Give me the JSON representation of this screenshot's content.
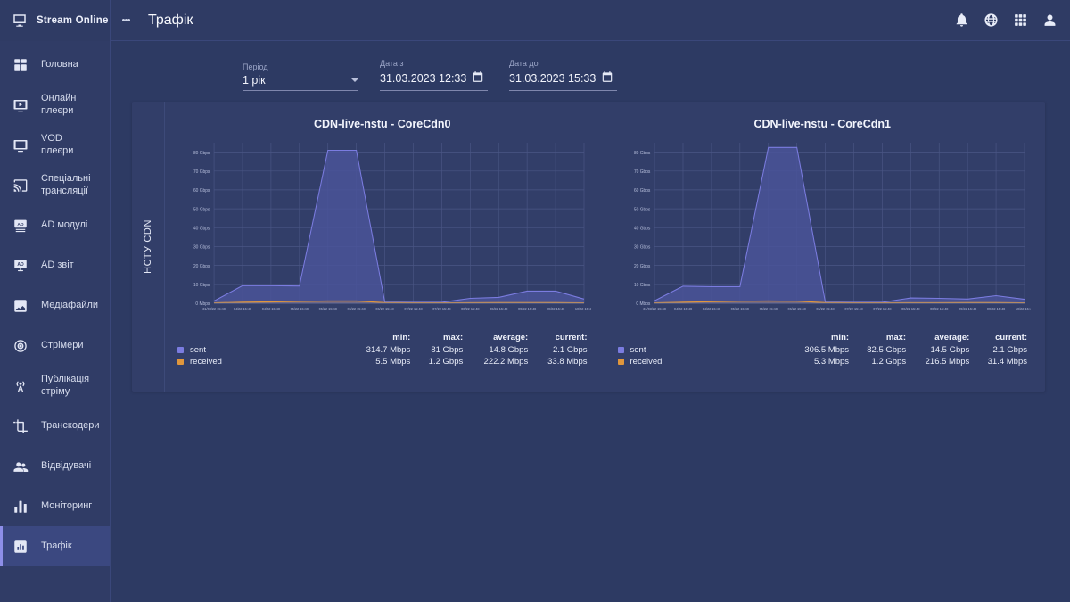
{
  "brand": {
    "title": "Stream Online",
    "icon": "monitor-stream-icon"
  },
  "sidebar": {
    "items": [
      {
        "label": "Головна",
        "icon": "dashboard-icon",
        "active": false
      },
      {
        "label": "Онлайн\nплеєри",
        "icon": "live-player-icon",
        "active": false
      },
      {
        "label": "VOD\nплеєри",
        "icon": "vod-player-icon",
        "active": false
      },
      {
        "label": "Спеціальні\nтрансляції",
        "icon": "cast-icon",
        "active": false
      },
      {
        "label": "AD модулі",
        "icon": "ad-module-icon",
        "active": false
      },
      {
        "label": "AD звіт",
        "icon": "ad-report-icon",
        "active": false
      },
      {
        "label": "Медіафайли",
        "icon": "media-files-icon",
        "active": false
      },
      {
        "label": "Стрімери",
        "icon": "streamers-icon",
        "active": false
      },
      {
        "label": "Публікація\nстріму",
        "icon": "broadcast-icon",
        "active": false
      },
      {
        "label": "Транскодери",
        "icon": "transcoder-icon",
        "active": false
      },
      {
        "label": "Відвідувачі",
        "icon": "visitors-icon",
        "active": false
      },
      {
        "label": "Моніторинг",
        "icon": "monitoring-icon",
        "active": false
      },
      {
        "label": "Трафік",
        "icon": "traffic-icon",
        "active": true
      }
    ]
  },
  "topbar": {
    "menu_icon": "kebab-menu-icon",
    "title": "Трафік",
    "icons": [
      {
        "name": "notifications-bell-icon"
      },
      {
        "name": "language-globe-icon"
      },
      {
        "name": "apps-grid-icon"
      },
      {
        "name": "user-account-icon"
      }
    ]
  },
  "filters": {
    "period": {
      "label": "Період",
      "value": "1 рік",
      "icon": "chevron-down-icon"
    },
    "date_from": {
      "label": "Дата з",
      "value": "31.03.2023 12:33",
      "icon": "calendar-icon"
    },
    "date_to": {
      "label": "Дата до",
      "value": "31.03.2023 15:33",
      "icon": "calendar-icon"
    }
  },
  "panel": {
    "group_label": "НСТУ CDN"
  },
  "colors": {
    "sent": "#7b7ce0",
    "received": "#e0963c",
    "sent_fill": "#4a5499",
    "page_bg": "#2d3a63",
    "panel_bg": "#323e69",
    "sidebar_bg": "#303c66",
    "accent": "#8d8ee8"
  },
  "stats_headers": {
    "name": "",
    "min": "min:",
    "max": "max:",
    "average": "average:",
    "current": "current:"
  },
  "chart_data": [
    {
      "type": "area",
      "title": "CDN-live-nstu - CoreCdn0",
      "xlabel": "",
      "ylabel": "",
      "ylim": [
        0,
        85
      ],
      "grid": true,
      "legend": "bottom-left",
      "yticks": [
        "0 Mbps",
        "10 Gbps",
        "20 Gbps",
        "30 Gbps",
        "40 Gbps",
        "50 Gbps",
        "60 Gbps",
        "70 Gbps",
        "80 Gbps"
      ],
      "xticks": [
        "31/03/22 15:48",
        "04/22 15:48",
        "04/22 15:48",
        "05/22 15:48",
        "05/22 15:48",
        "06/22 15:48",
        "06/22 15:48",
        "07/22 15:48",
        "07/22 15:48",
        "08/22 15:48",
        "08/22 15:48",
        "09/22 15:48",
        "09/22 15:48",
        "10/22 15:48"
      ],
      "series": [
        {
          "name": "sent",
          "color": "#7b7ce0",
          "values": [
            1.2,
            9.3,
            9.3,
            9.1,
            81,
            81,
            0.6,
            0.5,
            0.5,
            2.6,
            3.1,
            6.4,
            6.4,
            2.2
          ],
          "min": "314.7 Mbps",
          "max": "81 Gbps",
          "average": "14.8 Gbps",
          "current": "2.1 Gbps"
        },
        {
          "name": "received",
          "color": "#e0963c",
          "values": [
            0.2,
            0.5,
            0.7,
            1.0,
            1.2,
            1.2,
            0.35,
            0.2,
            0.2,
            0.25,
            0.3,
            0.35,
            0.3,
            0.2
          ],
          "min": "5.5 Mbps",
          "max": "1.2 Gbps",
          "average": "222.2 Mbps",
          "current": "33.8 Mbps"
        }
      ]
    },
    {
      "type": "area",
      "title": "CDN-live-nstu - CoreCdn1",
      "xlabel": "",
      "ylabel": "",
      "ylim": [
        0,
        85
      ],
      "grid": true,
      "legend": "bottom-left",
      "yticks": [
        "0 Mbps",
        "10 Gbps",
        "20 Gbps",
        "30 Gbps",
        "40 Gbps",
        "50 Gbps",
        "60 Gbps",
        "70 Gbps",
        "80 Gbps"
      ],
      "xticks": [
        "31/03/22 15:48",
        "04/22 15:48",
        "04/22 15:48",
        "05/22 15:48",
        "05/22 15:48",
        "06/22 15:48",
        "06/22 15:48",
        "07/22 15:48",
        "07/22 15:48",
        "08/22 15:48",
        "08/22 15:48",
        "09/22 15:48",
        "09/22 15:48",
        "10/22 15:48"
      ],
      "series": [
        {
          "name": "sent",
          "color": "#7b7ce0",
          "values": [
            1.3,
            9.0,
            8.8,
            8.8,
            82.5,
            82.5,
            0.6,
            0.5,
            0.5,
            2.8,
            2.6,
            2.2,
            4.0,
            2.1
          ],
          "min": "306.5 Mbps",
          "max": "82.5 Gbps",
          "average": "14.5 Gbps",
          "current": "2.1 Gbps"
        },
        {
          "name": "received",
          "color": "#e0963c",
          "values": [
            0.2,
            0.5,
            0.8,
            1.1,
            1.2,
            1.1,
            0.3,
            0.2,
            0.2,
            0.25,
            0.25,
            0.3,
            0.3,
            0.2
          ],
          "min": "5.3 Mbps",
          "max": "1.2 Gbps",
          "average": "216.5 Mbps",
          "current": "31.4 Mbps"
        }
      ]
    }
  ]
}
